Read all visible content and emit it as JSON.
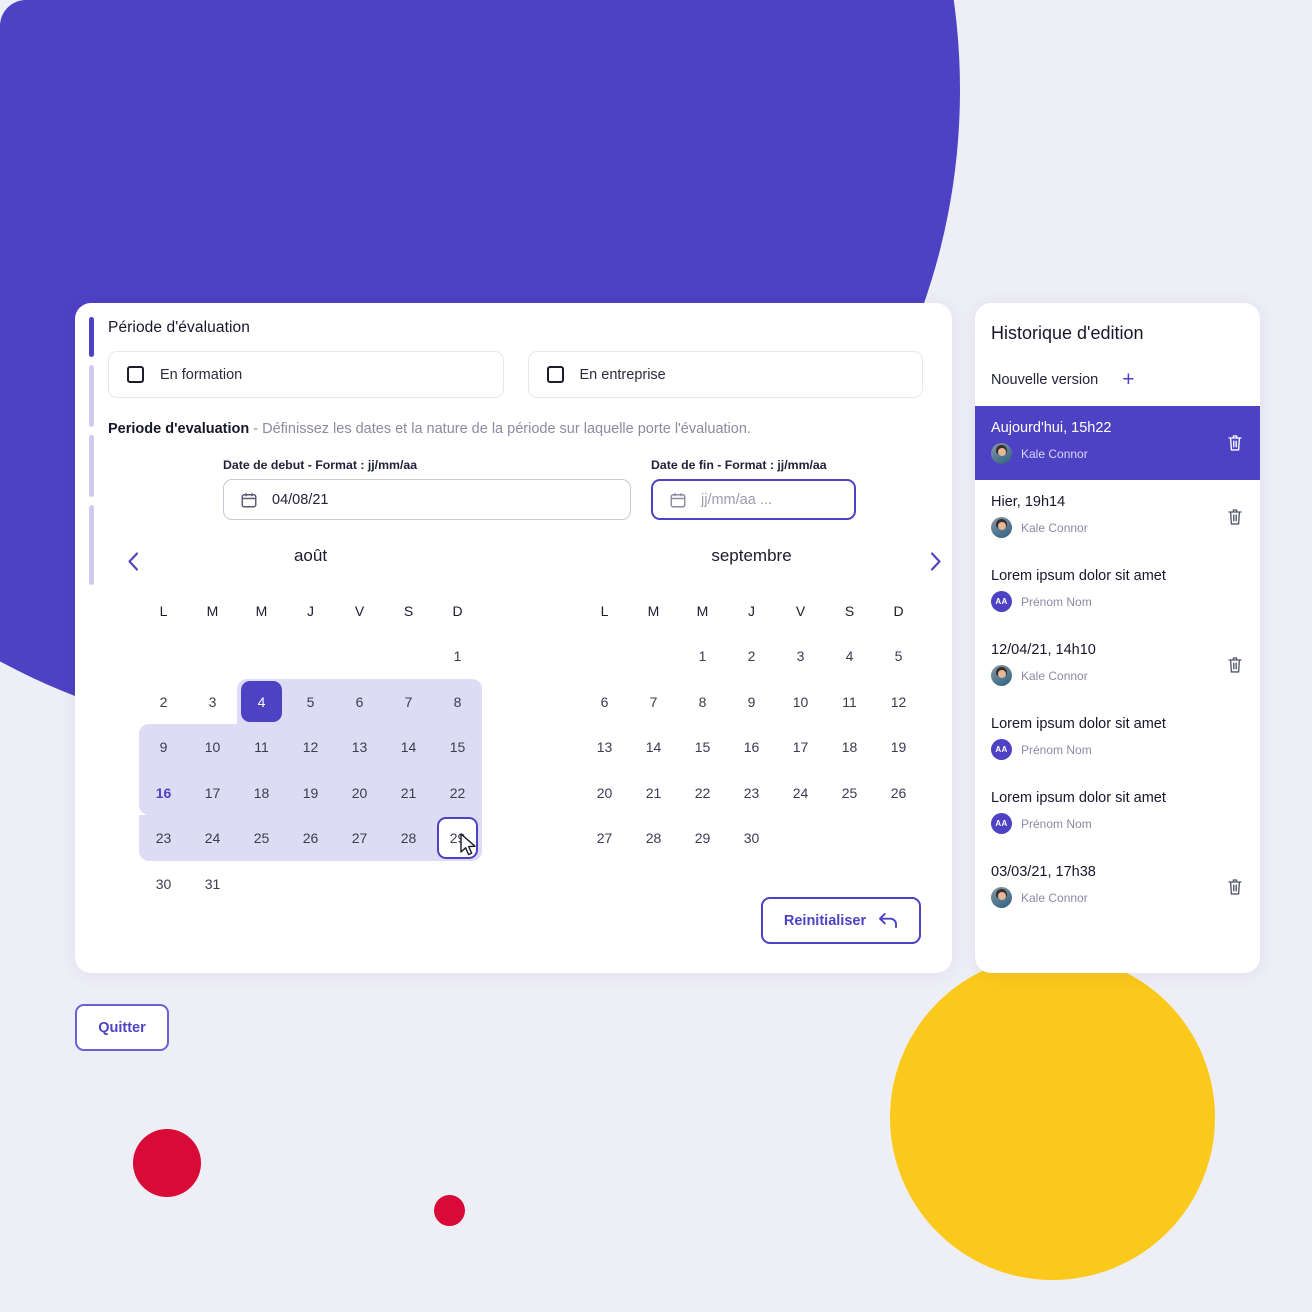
{
  "colors": {
    "brand_purple": "#4d42c4",
    "range_light": "#dedcf5",
    "yellow": "#fbc91b",
    "red": "#d80a36",
    "page_bg": "#eeeef7"
  },
  "form": {
    "section_title": "Période d'évaluation",
    "checkboxes": [
      {
        "label": "En formation",
        "checked": false
      },
      {
        "label": "En entreprise",
        "checked": false
      }
    ],
    "sub_heading": "Periode d'evaluation",
    "sub_heading_desc": "- Définissez les dates et la nature de la période sur laquelle porte l'évaluation.",
    "start_date": {
      "label": "Date de debut - Format : jj/mm/aa",
      "value": "04/08/21",
      "placeholder": "jj/mm/aa ...",
      "icon": "calendar-icon",
      "focused": false
    },
    "end_date": {
      "label": "Date de fin - Format : jj/mm/aa",
      "value": "",
      "placeholder": "jj/mm/aa ...",
      "icon": "calendar-icon",
      "focused": true
    },
    "reset_button": "Reinitialiser",
    "reset_icon": "undo-arrow-icon"
  },
  "calendars": {
    "prev_icon": "chevron-left-icon",
    "next_icon": "chevron-right-icon",
    "weekday_headers": [
      "L",
      "M",
      "M",
      "J",
      "V",
      "S",
      "D"
    ],
    "left": {
      "month": "août",
      "lead_blanks": 6,
      "days": [
        1,
        2,
        3,
        4,
        5,
        6,
        7,
        8,
        9,
        10,
        11,
        12,
        13,
        14,
        15,
        16,
        17,
        18,
        19,
        20,
        21,
        22,
        23,
        24,
        25,
        26,
        27,
        28,
        29,
        30,
        31
      ],
      "selected_day": 4,
      "today_day": 16,
      "hover_day": 29
    },
    "right": {
      "month": "septembre",
      "lead_blanks": 2,
      "days": [
        1,
        2,
        3,
        4,
        5,
        6,
        7,
        8,
        9,
        10,
        11,
        12,
        13,
        14,
        15,
        16,
        17,
        18,
        19,
        20,
        21,
        22,
        23,
        24,
        25,
        26,
        27,
        28,
        29,
        30
      ],
      "selected_day": null,
      "today_day": null,
      "hover_day": null
    }
  },
  "history": {
    "title": "Historique d'edition",
    "new_version_label": "Nouvelle version",
    "new_version_icon": "plus-icon",
    "delete_icon": "trash-icon",
    "items": [
      {
        "title": "Aujourd'hui, 15h22",
        "author": "Kale Connor",
        "avatar": "photo",
        "initials": "",
        "active": true,
        "deletable": true
      },
      {
        "title": "Hier, 19h14",
        "author": "Kale Connor",
        "avatar": "photo",
        "initials": "",
        "active": false,
        "deletable": true
      },
      {
        "title": "Lorem ipsum dolor sit amet",
        "author": "Prénom Nom",
        "avatar": "initials",
        "initials": "AA",
        "active": false,
        "deletable": false
      },
      {
        "title": "12/04/21, 14h10",
        "author": "Kale Connor",
        "avatar": "photo",
        "initials": "",
        "active": false,
        "deletable": true
      },
      {
        "title": "Lorem ipsum dolor sit amet",
        "author": "Prénom Nom",
        "avatar": "initials",
        "initials": "AA",
        "active": false,
        "deletable": false
      },
      {
        "title": "Lorem ipsum dolor sit amet",
        "author": "Prénom Nom",
        "avatar": "initials",
        "initials": "AA",
        "active": false,
        "deletable": false
      },
      {
        "title": "03/03/21, 17h38",
        "author": "Kale Connor",
        "avatar": "photo",
        "initials": "",
        "active": false,
        "deletable": true
      }
    ]
  },
  "footer": {
    "quit_button": "Quitter"
  }
}
